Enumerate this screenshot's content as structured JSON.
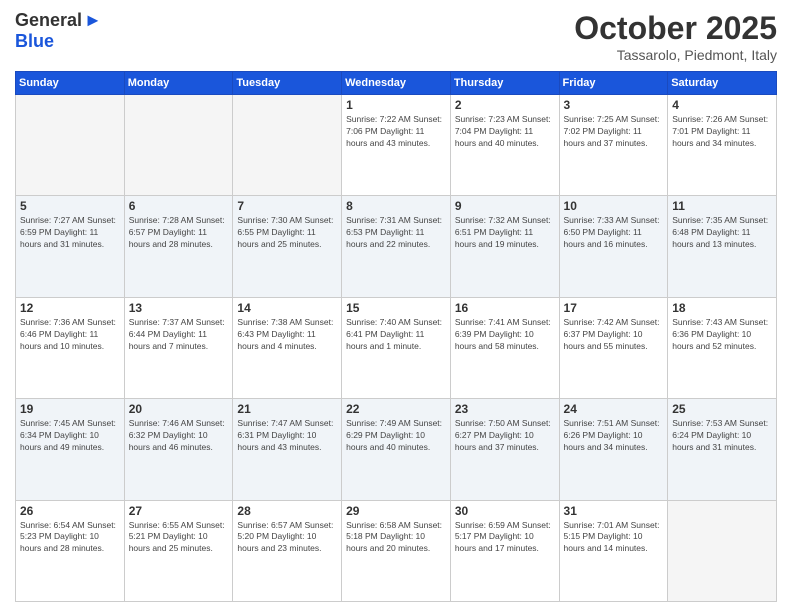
{
  "logo": {
    "general": "General",
    "blue": "Blue",
    "arrow": "▶"
  },
  "title": "October 2025",
  "location": "Tassarolo, Piedmont, Italy",
  "days_of_week": [
    "Sunday",
    "Monday",
    "Tuesday",
    "Wednesday",
    "Thursday",
    "Friday",
    "Saturday"
  ],
  "weeks": [
    [
      {
        "day": "",
        "info": ""
      },
      {
        "day": "",
        "info": ""
      },
      {
        "day": "",
        "info": ""
      },
      {
        "day": "1",
        "info": "Sunrise: 7:22 AM\nSunset: 7:06 PM\nDaylight: 11 hours and 43 minutes."
      },
      {
        "day": "2",
        "info": "Sunrise: 7:23 AM\nSunset: 7:04 PM\nDaylight: 11 hours and 40 minutes."
      },
      {
        "day": "3",
        "info": "Sunrise: 7:25 AM\nSunset: 7:02 PM\nDaylight: 11 hours and 37 minutes."
      },
      {
        "day": "4",
        "info": "Sunrise: 7:26 AM\nSunset: 7:01 PM\nDaylight: 11 hours and 34 minutes."
      }
    ],
    [
      {
        "day": "5",
        "info": "Sunrise: 7:27 AM\nSunset: 6:59 PM\nDaylight: 11 hours and 31 minutes."
      },
      {
        "day": "6",
        "info": "Sunrise: 7:28 AM\nSunset: 6:57 PM\nDaylight: 11 hours and 28 minutes."
      },
      {
        "day": "7",
        "info": "Sunrise: 7:30 AM\nSunset: 6:55 PM\nDaylight: 11 hours and 25 minutes."
      },
      {
        "day": "8",
        "info": "Sunrise: 7:31 AM\nSunset: 6:53 PM\nDaylight: 11 hours and 22 minutes."
      },
      {
        "day": "9",
        "info": "Sunrise: 7:32 AM\nSunset: 6:51 PM\nDaylight: 11 hours and 19 minutes."
      },
      {
        "day": "10",
        "info": "Sunrise: 7:33 AM\nSunset: 6:50 PM\nDaylight: 11 hours and 16 minutes."
      },
      {
        "day": "11",
        "info": "Sunrise: 7:35 AM\nSunset: 6:48 PM\nDaylight: 11 hours and 13 minutes."
      }
    ],
    [
      {
        "day": "12",
        "info": "Sunrise: 7:36 AM\nSunset: 6:46 PM\nDaylight: 11 hours and 10 minutes."
      },
      {
        "day": "13",
        "info": "Sunrise: 7:37 AM\nSunset: 6:44 PM\nDaylight: 11 hours and 7 minutes."
      },
      {
        "day": "14",
        "info": "Sunrise: 7:38 AM\nSunset: 6:43 PM\nDaylight: 11 hours and 4 minutes."
      },
      {
        "day": "15",
        "info": "Sunrise: 7:40 AM\nSunset: 6:41 PM\nDaylight: 11 hours and 1 minute."
      },
      {
        "day": "16",
        "info": "Sunrise: 7:41 AM\nSunset: 6:39 PM\nDaylight: 10 hours and 58 minutes."
      },
      {
        "day": "17",
        "info": "Sunrise: 7:42 AM\nSunset: 6:37 PM\nDaylight: 10 hours and 55 minutes."
      },
      {
        "day": "18",
        "info": "Sunrise: 7:43 AM\nSunset: 6:36 PM\nDaylight: 10 hours and 52 minutes."
      }
    ],
    [
      {
        "day": "19",
        "info": "Sunrise: 7:45 AM\nSunset: 6:34 PM\nDaylight: 10 hours and 49 minutes."
      },
      {
        "day": "20",
        "info": "Sunrise: 7:46 AM\nSunset: 6:32 PM\nDaylight: 10 hours and 46 minutes."
      },
      {
        "day": "21",
        "info": "Sunrise: 7:47 AM\nSunset: 6:31 PM\nDaylight: 10 hours and 43 minutes."
      },
      {
        "day": "22",
        "info": "Sunrise: 7:49 AM\nSunset: 6:29 PM\nDaylight: 10 hours and 40 minutes."
      },
      {
        "day": "23",
        "info": "Sunrise: 7:50 AM\nSunset: 6:27 PM\nDaylight: 10 hours and 37 minutes."
      },
      {
        "day": "24",
        "info": "Sunrise: 7:51 AM\nSunset: 6:26 PM\nDaylight: 10 hours and 34 minutes."
      },
      {
        "day": "25",
        "info": "Sunrise: 7:53 AM\nSunset: 6:24 PM\nDaylight: 10 hours and 31 minutes."
      }
    ],
    [
      {
        "day": "26",
        "info": "Sunrise: 6:54 AM\nSunset: 5:23 PM\nDaylight: 10 hours and 28 minutes."
      },
      {
        "day": "27",
        "info": "Sunrise: 6:55 AM\nSunset: 5:21 PM\nDaylight: 10 hours and 25 minutes."
      },
      {
        "day": "28",
        "info": "Sunrise: 6:57 AM\nSunset: 5:20 PM\nDaylight: 10 hours and 23 minutes."
      },
      {
        "day": "29",
        "info": "Sunrise: 6:58 AM\nSunset: 5:18 PM\nDaylight: 10 hours and 20 minutes."
      },
      {
        "day": "30",
        "info": "Sunrise: 6:59 AM\nSunset: 5:17 PM\nDaylight: 10 hours and 17 minutes."
      },
      {
        "day": "31",
        "info": "Sunrise: 7:01 AM\nSunset: 5:15 PM\nDaylight: 10 hours and 14 minutes."
      },
      {
        "day": "",
        "info": ""
      }
    ]
  ]
}
